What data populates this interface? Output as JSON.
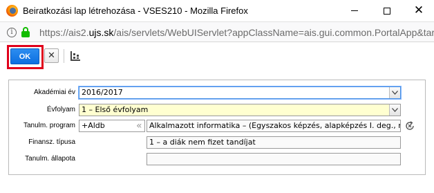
{
  "window": {
    "title": "Beiratkozási lap létrehozása - VSES210 - Mozilla Firefox",
    "minimize_icon": "minimize-icon",
    "maximize_icon": "maximize-icon",
    "close_glyph": "✕"
  },
  "urlbar": {
    "scheme": "https://ais2.",
    "domain": "ujs.sk",
    "rest": "/ais/servlets/WebUIServlet?appClassName=ais.gui.common.PortalApp&targ",
    "info_glyph": "i",
    "secure_color": "#12bc00"
  },
  "toolbar": {
    "ok_label": "OK",
    "cancel_glyph": "✕",
    "highlight_color": "#e0001b"
  },
  "form": {
    "akademiai_ev": {
      "label": "Akadémiai év",
      "value": "2016/2017"
    },
    "evfolyam": {
      "label": "Évfolyam",
      "value": "1 – Első évfolyam"
    },
    "tanulm_program": {
      "label": "Tanulm. program",
      "code": "+Aldb",
      "chevron_glyph": "«",
      "description": "Alkalmazott informatika – (Egyszakos képzés, alapképzés I. deg., n"
    },
    "finansz_tipusa": {
      "label": "Finansz. típusa",
      "value": "1 – a diák nem fizet tandíjat"
    },
    "tanulm_allapota": {
      "label": "Tanulm. állapota",
      "value": ""
    }
  },
  "colors": {
    "focus_border": "#4a90e2",
    "required_bg": "#ffffd0",
    "ok_bg": "#1a7ee8"
  }
}
